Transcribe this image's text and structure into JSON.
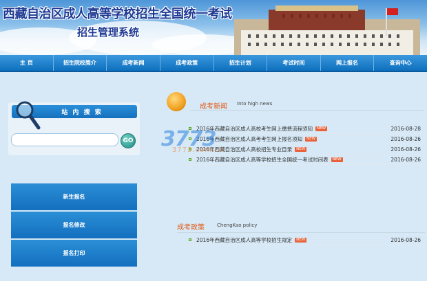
{
  "header": {
    "title": "西藏自治区成人高等学校招生全国统一考试",
    "subtitle": "招生管理系统"
  },
  "nav": [
    "主 页",
    "招生院校简介",
    "成考新闻",
    "成考政策",
    "招生计划",
    "考试时间",
    "网上报名",
    "查询中心"
  ],
  "search": {
    "title": "站 内 搜 索",
    "placeholder": "",
    "go_label": "GO"
  },
  "menu": [
    "新生报名",
    "报名修改",
    "报名打印"
  ],
  "news": {
    "title": "成考新闻",
    "subtitle": "Into high news",
    "items": [
      {
        "title": "2016年西藏自治区成人高校考生网上缴费流程须知",
        "date": "2016-08-28",
        "badge": "NEW"
      },
      {
        "title": "2016年西藏自治区成人高考考生网上报名须知",
        "date": "2016-08-26",
        "badge": "NEW"
      },
      {
        "title": "2016年西藏自治区成人高校招生专业目录",
        "date": "2016-08-26",
        "badge": "NEW"
      },
      {
        "title": "2016年西藏自治区成人高等学校招生全国统一考试时间表",
        "date": "2016-08-26",
        "badge": "NEW"
      }
    ]
  },
  "policy": {
    "title": "成考政策",
    "subtitle": "ChengKao policy",
    "items": [
      {
        "title": "2016年西藏自治区成人高等学校招生规定",
        "date": "2016-08-26",
        "badge": "NEW"
      }
    ]
  },
  "watermark": {
    "big": "3773",
    "small": "3773.com.cn"
  }
}
